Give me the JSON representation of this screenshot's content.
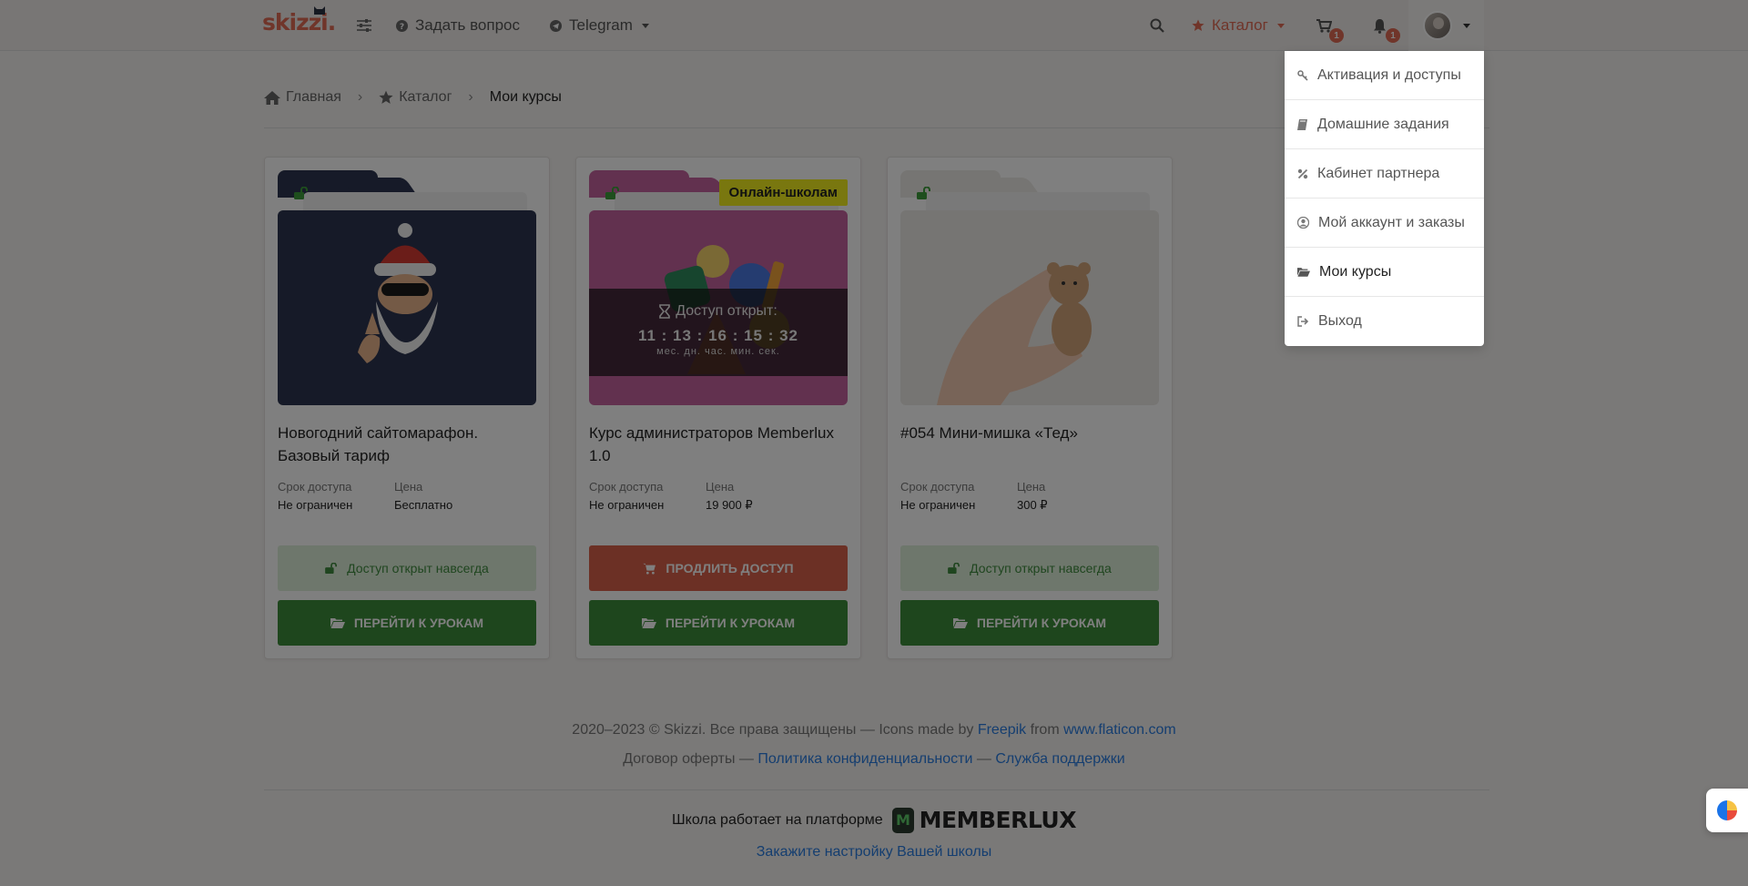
{
  "header": {
    "logo": "skizzi.",
    "ask_label": "Задать вопрос",
    "telegram_label": "Telegram",
    "catalog_label": "Каталог",
    "cart_count": "1",
    "notifications_count": "1"
  },
  "breadcrumb": {
    "home": "Главная",
    "catalog": "Каталог",
    "current": "Мои курсы"
  },
  "courses": [
    {
      "title": "Новогодний сайтомарафон. Базовый тариф",
      "access_label": "Срок доступа",
      "access_value": "Не ограничен",
      "price_label": "Цена",
      "price_value": "Бесплатно",
      "status_button": "Доступ открыт навсегда",
      "lessons_button": "Перейти к урокам"
    },
    {
      "title": "Курс администраторов Memberlux 1.0",
      "ribbon": "Онлайн-школам",
      "timer_label": "Доступ открыт:",
      "timer_digits": "11 : 13 : 16 : 15 : 32",
      "timer_units": "мес. дн. час. мин. сек.",
      "access_label": "Срок доступа",
      "access_value": "Не ограничен",
      "price_label": "Цена",
      "price_value": "19 900 ₽",
      "status_button": "Продлить доступ",
      "lessons_button": "Перейти к урокам"
    },
    {
      "title": "#054 Мини-мишка «Тед»",
      "access_label": "Срок доступа",
      "access_value": "Не ограничен",
      "price_label": "Цена",
      "price_value": "300 ₽",
      "status_button": "Доступ открыт навсегда",
      "lessons_button": "Перейти к урокам"
    }
  ],
  "footer": {
    "copyright_text": "2020–2023 © Skizzi. Все права защищены — Icons made by",
    "freepik": "Freepik",
    "from_text": "from",
    "flaticon": "www.flaticon.com",
    "offer": "Договор оферты",
    "dash1": "—",
    "privacy": "Политика конфиденциальности",
    "dash2": "—",
    "support": "Служба поддержки",
    "platform_text": "Школа работает на платформе",
    "platform_brand": "MEMBERLUX",
    "setup_link": "Закажите настройку Вашей школы"
  },
  "user_menu": {
    "items": [
      {
        "label": "Активация и доступы",
        "icon": "key-icon"
      },
      {
        "label": "Домашние задания",
        "icon": "book-icon"
      },
      {
        "label": "Кабинет партнера",
        "icon": "percent-icon"
      },
      {
        "label": "Мой аккаунт и заказы",
        "icon": "user-circle-icon"
      },
      {
        "label": "Мои курсы",
        "icon": "folder-open-icon"
      },
      {
        "label": "Выход",
        "icon": "sign-out-icon"
      }
    ]
  },
  "colors": {
    "brand": "#e06b55",
    "success": "#3d8c3a",
    "danger": "#d8604a",
    "link": "#2a7de0",
    "ribbon": "#f3ef1e"
  }
}
